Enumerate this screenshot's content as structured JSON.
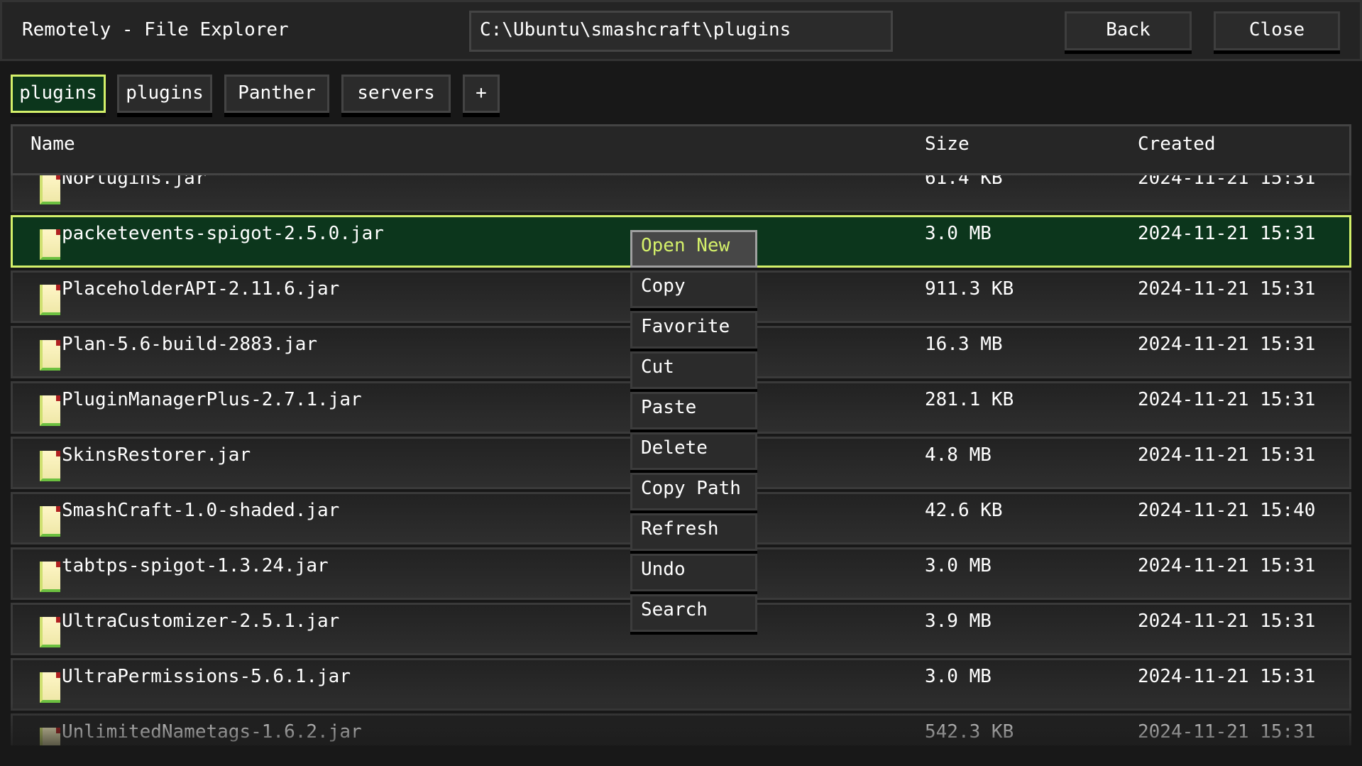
{
  "window": {
    "title": "Remotely - File Explorer",
    "path": "C:\\Ubuntu\\smashcraft\\plugins",
    "back_label": "Back",
    "close_label": "Close"
  },
  "tabs": [
    {
      "label": "plugins",
      "active": true
    },
    {
      "label": "plugins"
    },
    {
      "label": "Panther"
    },
    {
      "label": "servers"
    },
    {
      "label": "+"
    }
  ],
  "columns": {
    "name": "Name",
    "size": "Size",
    "created": "Created"
  },
  "files": [
    {
      "name": "NoPlugins.jar",
      "size": "61.4 KB",
      "created": "2024-11-21 15:31"
    },
    {
      "name": "packetevents-spigot-2.5.0.jar",
      "size": "3.0 MB",
      "created": "2024-11-21 15:31",
      "selected": true
    },
    {
      "name": "PlaceholderAPI-2.11.6.jar",
      "size": "911.3 KB",
      "created": "2024-11-21 15:31"
    },
    {
      "name": "Plan-5.6-build-2883.jar",
      "size": "16.3 MB",
      "created": "2024-11-21 15:31"
    },
    {
      "name": "PluginManagerPlus-2.7.1.jar",
      "size": "281.1 KB",
      "created": "2024-11-21 15:31"
    },
    {
      "name": "SkinsRestorer.jar",
      "size": "4.8 MB",
      "created": "2024-11-21 15:31"
    },
    {
      "name": "SmashCraft-1.0-shaded.jar",
      "size": "42.6 KB",
      "created": "2024-11-21 15:40"
    },
    {
      "name": "tabtps-spigot-1.3.24.jar",
      "size": "3.0 MB",
      "created": "2024-11-21 15:31"
    },
    {
      "name": "UltraCustomizer-2.5.1.jar",
      "size": "3.9 MB",
      "created": "2024-11-21 15:31"
    },
    {
      "name": "UltraPermissions-5.6.1.jar",
      "size": "3.0 MB",
      "created": "2024-11-21 15:31"
    },
    {
      "name": "UnlimitedNametags-1.6.2.jar",
      "size": "542.3 KB",
      "created": "2024-11-21 15:31"
    }
  ],
  "context_menu": [
    "Open New",
    "Copy",
    "Favorite",
    "Cut",
    "Paste",
    "Delete",
    "Copy Path",
    "Refresh",
    "Undo",
    "Search"
  ],
  "icons": {
    "file": "jar-file-icon"
  },
  "colors": {
    "accent": "#d4f06a",
    "selected_bg": "#0c361c"
  }
}
